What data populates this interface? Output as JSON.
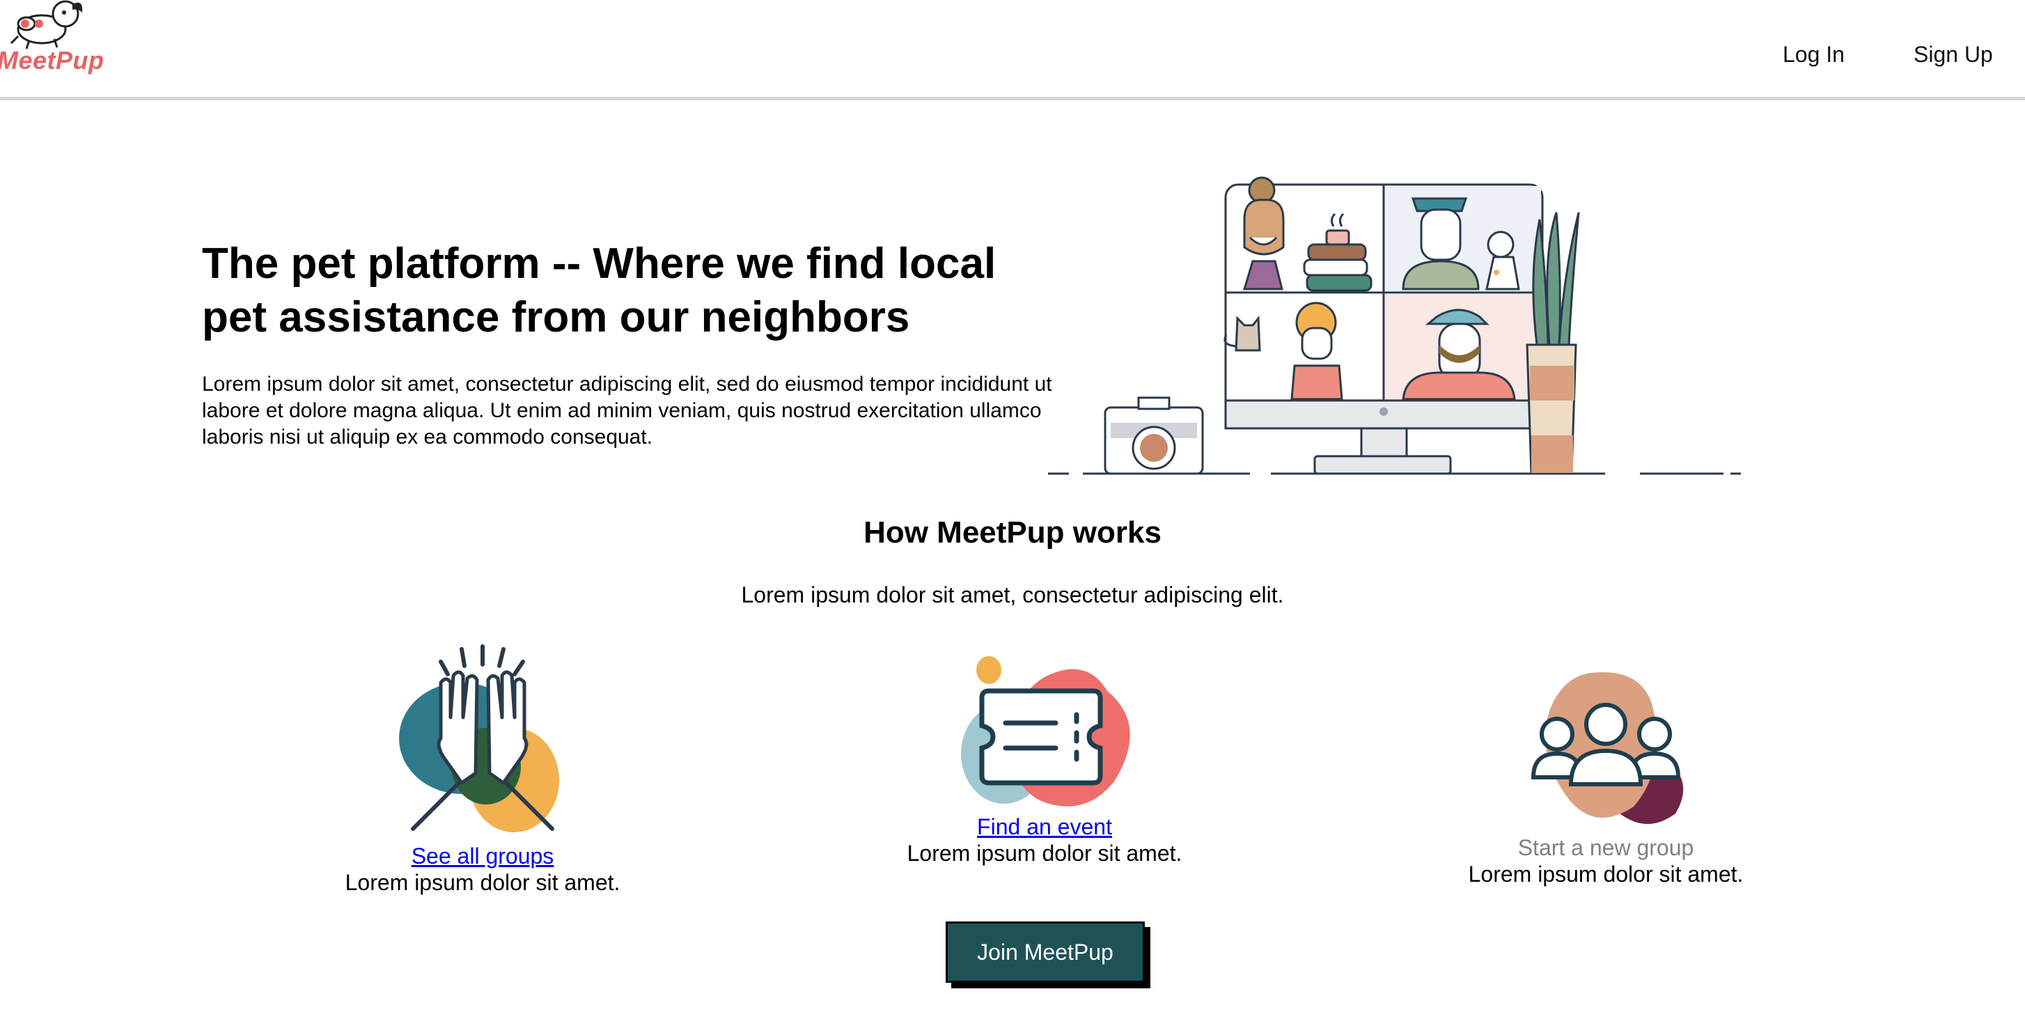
{
  "header": {
    "logo_text": "MeetPup",
    "nav": {
      "login": "Log In",
      "signup": "Sign Up"
    }
  },
  "hero": {
    "title": "The pet platform -- Where we find local pet assistance from our neighbors",
    "body": "Lorem ipsum dolor sit amet, consectetur adipiscing elit, sed do eiusmod tempor incididunt ut labore et dolore magna aliqua. Ut enim ad minim veniam, quis nostrud exercitation ullamco laboris nisi ut aliquip ex ea commodo consequat."
  },
  "how": {
    "title": "How MeetPup works",
    "subtitle": "Lorem ipsum dolor sit amet, consectetur adipiscing elit."
  },
  "features": [
    {
      "label": "See all groups",
      "desc": "Lorem ipsum dolor sit amet.",
      "icon": "high-five-icon"
    },
    {
      "label": "Find an event",
      "desc": "Lorem ipsum dolor sit amet.",
      "icon": "ticket-icon"
    },
    {
      "label": "Start a new group",
      "desc": "Lorem ipsum dolor sit amet.",
      "icon": "people-group-icon"
    }
  ],
  "cta": {
    "join_label": "Join MeetPup"
  },
  "colors": {
    "brand": "#e46464",
    "button_bg": "#1f5257",
    "teal": "#2f7a8a",
    "orange": "#f2b04e",
    "coral": "#ee6e6c",
    "maroon": "#6e2545",
    "tan": "#dba080"
  }
}
